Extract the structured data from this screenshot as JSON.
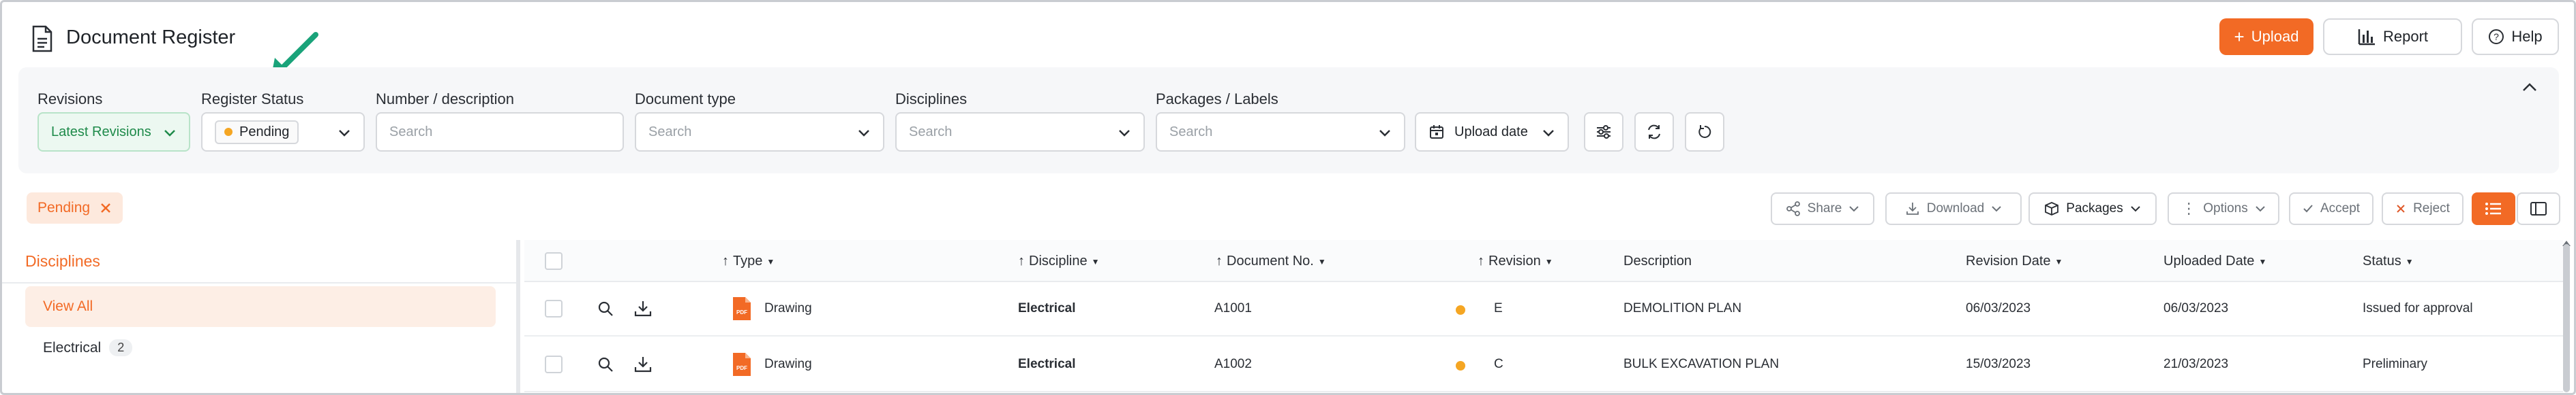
{
  "header": {
    "title": "Document Register",
    "upload_label": "Upload",
    "report_label": "Report",
    "help_label": "Help"
  },
  "filters": {
    "revisions": {
      "label": "Revisions",
      "value": "Latest Revisions"
    },
    "register_status": {
      "label": "Register Status",
      "value": "Pending"
    },
    "number_description": {
      "label": "Number / description",
      "placeholder": "Search"
    },
    "document_type": {
      "label": "Document type",
      "placeholder": "Search"
    },
    "disciplines": {
      "label": "Disciplines",
      "placeholder": "Search"
    },
    "packages_labels": {
      "label": "Packages / Labels",
      "placeholder": "Search"
    },
    "upload_date": {
      "value": "Upload date"
    }
  },
  "active_filter": {
    "label": "Pending"
  },
  "toolbar": {
    "share": "Share",
    "download": "Download",
    "packages": "Packages",
    "options": "Options",
    "accept": "Accept",
    "reject": "Reject"
  },
  "sidebar": {
    "title": "Disciplines",
    "view_all": "View All",
    "items": [
      {
        "label": "Electrical",
        "count": "2"
      }
    ]
  },
  "table": {
    "columns": {
      "type": "Type",
      "discipline": "Discipline",
      "document_no": "Document No.",
      "revision": "Revision",
      "description": "Description",
      "revision_date": "Revision Date",
      "uploaded_date": "Uploaded Date",
      "status": "Status"
    },
    "rows": [
      {
        "type": "Drawing",
        "discipline": "Electrical",
        "document_no": "A1001",
        "revision": "E",
        "description": "DEMOLITION PLAN",
        "revision_date": "06/03/2023",
        "uploaded_date": "06/03/2023",
        "status": "Issued for approval"
      },
      {
        "type": "Drawing",
        "discipline": "Electrical",
        "document_no": "A1002",
        "revision": "C",
        "description": "BULK EXCAVATION PLAN",
        "revision_date": "15/03/2023",
        "uploaded_date": "21/03/2023",
        "status": "Preliminary"
      }
    ]
  },
  "colors": {
    "accent": "#f26a25",
    "pending": "#f5a623",
    "revision_green": "#1e8a4a",
    "annotation": "#1aa37a"
  }
}
